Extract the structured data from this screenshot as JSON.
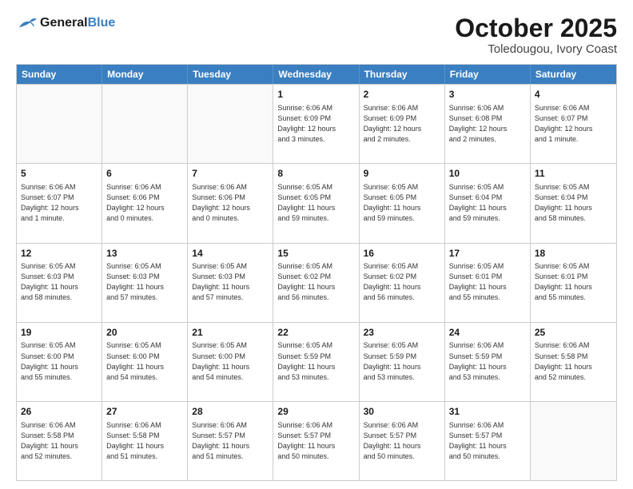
{
  "header": {
    "logo_general": "General",
    "logo_blue": "Blue",
    "month_title": "October 2025",
    "location": "Toledougou, Ivory Coast"
  },
  "days_of_week": [
    "Sunday",
    "Monday",
    "Tuesday",
    "Wednesday",
    "Thursday",
    "Friday",
    "Saturday"
  ],
  "weeks": [
    [
      {
        "day": "",
        "info": ""
      },
      {
        "day": "",
        "info": ""
      },
      {
        "day": "",
        "info": ""
      },
      {
        "day": "1",
        "info": "Sunrise: 6:06 AM\nSunset: 6:09 PM\nDaylight: 12 hours\nand 3 minutes."
      },
      {
        "day": "2",
        "info": "Sunrise: 6:06 AM\nSunset: 6:09 PM\nDaylight: 12 hours\nand 2 minutes."
      },
      {
        "day": "3",
        "info": "Sunrise: 6:06 AM\nSunset: 6:08 PM\nDaylight: 12 hours\nand 2 minutes."
      },
      {
        "day": "4",
        "info": "Sunrise: 6:06 AM\nSunset: 6:07 PM\nDaylight: 12 hours\nand 1 minute."
      }
    ],
    [
      {
        "day": "5",
        "info": "Sunrise: 6:06 AM\nSunset: 6:07 PM\nDaylight: 12 hours\nand 1 minute."
      },
      {
        "day": "6",
        "info": "Sunrise: 6:06 AM\nSunset: 6:06 PM\nDaylight: 12 hours\nand 0 minutes."
      },
      {
        "day": "7",
        "info": "Sunrise: 6:06 AM\nSunset: 6:06 PM\nDaylight: 12 hours\nand 0 minutes."
      },
      {
        "day": "8",
        "info": "Sunrise: 6:05 AM\nSunset: 6:05 PM\nDaylight: 11 hours\nand 59 minutes."
      },
      {
        "day": "9",
        "info": "Sunrise: 6:05 AM\nSunset: 6:05 PM\nDaylight: 11 hours\nand 59 minutes."
      },
      {
        "day": "10",
        "info": "Sunrise: 6:05 AM\nSunset: 6:04 PM\nDaylight: 11 hours\nand 59 minutes."
      },
      {
        "day": "11",
        "info": "Sunrise: 6:05 AM\nSunset: 6:04 PM\nDaylight: 11 hours\nand 58 minutes."
      }
    ],
    [
      {
        "day": "12",
        "info": "Sunrise: 6:05 AM\nSunset: 6:03 PM\nDaylight: 11 hours\nand 58 minutes."
      },
      {
        "day": "13",
        "info": "Sunrise: 6:05 AM\nSunset: 6:03 PM\nDaylight: 11 hours\nand 57 minutes."
      },
      {
        "day": "14",
        "info": "Sunrise: 6:05 AM\nSunset: 6:03 PM\nDaylight: 11 hours\nand 57 minutes."
      },
      {
        "day": "15",
        "info": "Sunrise: 6:05 AM\nSunset: 6:02 PM\nDaylight: 11 hours\nand 56 minutes."
      },
      {
        "day": "16",
        "info": "Sunrise: 6:05 AM\nSunset: 6:02 PM\nDaylight: 11 hours\nand 56 minutes."
      },
      {
        "day": "17",
        "info": "Sunrise: 6:05 AM\nSunset: 6:01 PM\nDaylight: 11 hours\nand 55 minutes."
      },
      {
        "day": "18",
        "info": "Sunrise: 6:05 AM\nSunset: 6:01 PM\nDaylight: 11 hours\nand 55 minutes."
      }
    ],
    [
      {
        "day": "19",
        "info": "Sunrise: 6:05 AM\nSunset: 6:00 PM\nDaylight: 11 hours\nand 55 minutes."
      },
      {
        "day": "20",
        "info": "Sunrise: 6:05 AM\nSunset: 6:00 PM\nDaylight: 11 hours\nand 54 minutes."
      },
      {
        "day": "21",
        "info": "Sunrise: 6:05 AM\nSunset: 6:00 PM\nDaylight: 11 hours\nand 54 minutes."
      },
      {
        "day": "22",
        "info": "Sunrise: 6:05 AM\nSunset: 5:59 PM\nDaylight: 11 hours\nand 53 minutes."
      },
      {
        "day": "23",
        "info": "Sunrise: 6:05 AM\nSunset: 5:59 PM\nDaylight: 11 hours\nand 53 minutes."
      },
      {
        "day": "24",
        "info": "Sunrise: 6:06 AM\nSunset: 5:59 PM\nDaylight: 11 hours\nand 53 minutes."
      },
      {
        "day": "25",
        "info": "Sunrise: 6:06 AM\nSunset: 5:58 PM\nDaylight: 11 hours\nand 52 minutes."
      }
    ],
    [
      {
        "day": "26",
        "info": "Sunrise: 6:06 AM\nSunset: 5:58 PM\nDaylight: 11 hours\nand 52 minutes."
      },
      {
        "day": "27",
        "info": "Sunrise: 6:06 AM\nSunset: 5:58 PM\nDaylight: 11 hours\nand 51 minutes."
      },
      {
        "day": "28",
        "info": "Sunrise: 6:06 AM\nSunset: 5:57 PM\nDaylight: 11 hours\nand 51 minutes."
      },
      {
        "day": "29",
        "info": "Sunrise: 6:06 AM\nSunset: 5:57 PM\nDaylight: 11 hours\nand 50 minutes."
      },
      {
        "day": "30",
        "info": "Sunrise: 6:06 AM\nSunset: 5:57 PM\nDaylight: 11 hours\nand 50 minutes."
      },
      {
        "day": "31",
        "info": "Sunrise: 6:06 AM\nSunset: 5:57 PM\nDaylight: 11 hours\nand 50 minutes."
      },
      {
        "day": "",
        "info": ""
      }
    ]
  ]
}
